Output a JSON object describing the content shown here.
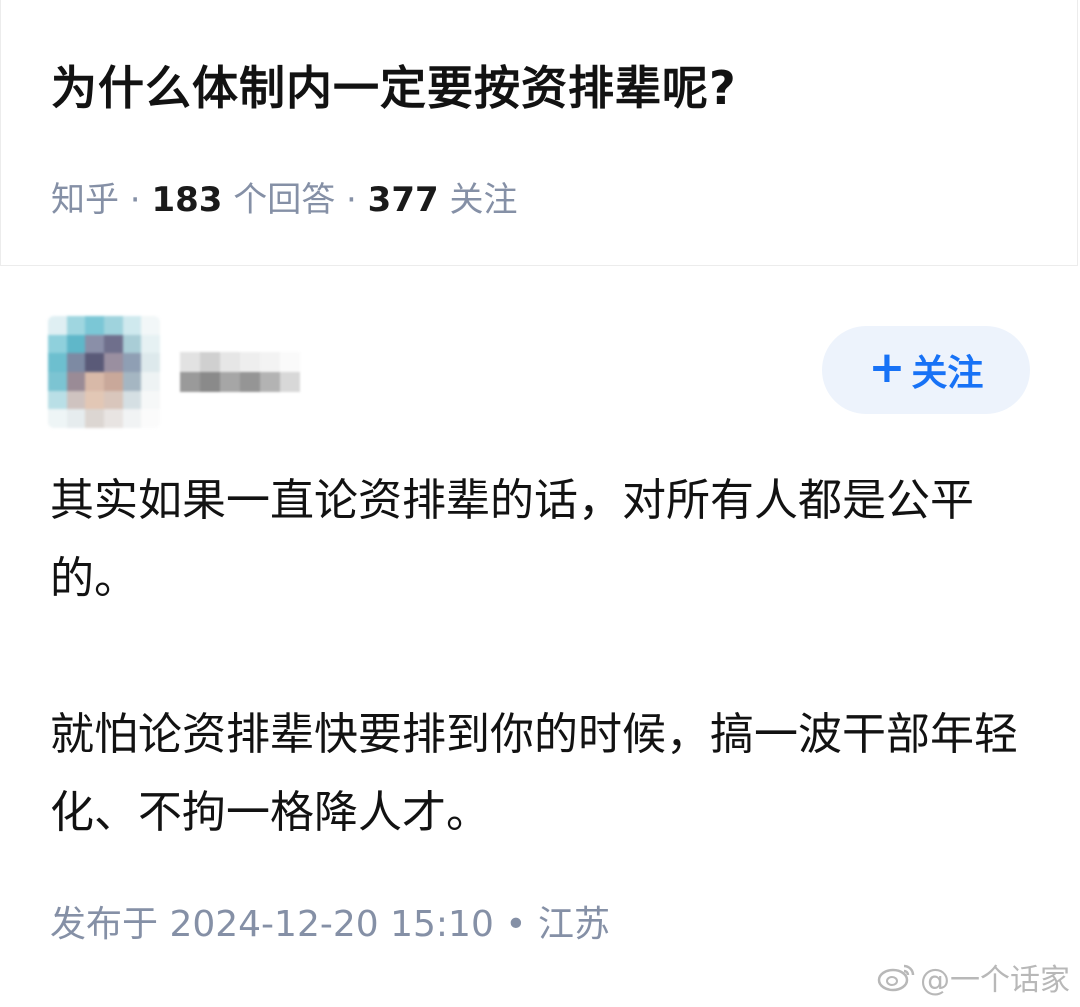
{
  "question": {
    "title": "为什么体制内一定要按资排辈呢?",
    "source": "知乎",
    "sep1": " · ",
    "answer_count": "183",
    "answer_label": " 个回答",
    "sep2": " · ",
    "follow_count": "377",
    "follow_label": " 关注"
  },
  "answer": {
    "follow_button": {
      "icon": "plus-icon",
      "label": "关注"
    },
    "paragraphs": [
      "其实如果一直论资排辈的话，对所有人都是公平的。",
      "就怕论资排辈快要排到你的时候，搞一波干部年轻化、不拘一格降人才。"
    ],
    "published": "发布于 2024-12-20 15:10 • 江苏"
  },
  "watermark": {
    "icon": "weibo-icon",
    "text": "@一个话家"
  },
  "colors": {
    "accent": "#1772f6",
    "follow_bg": "#edf3fc",
    "meta_gray": "#8590a6",
    "text": "#121212"
  }
}
